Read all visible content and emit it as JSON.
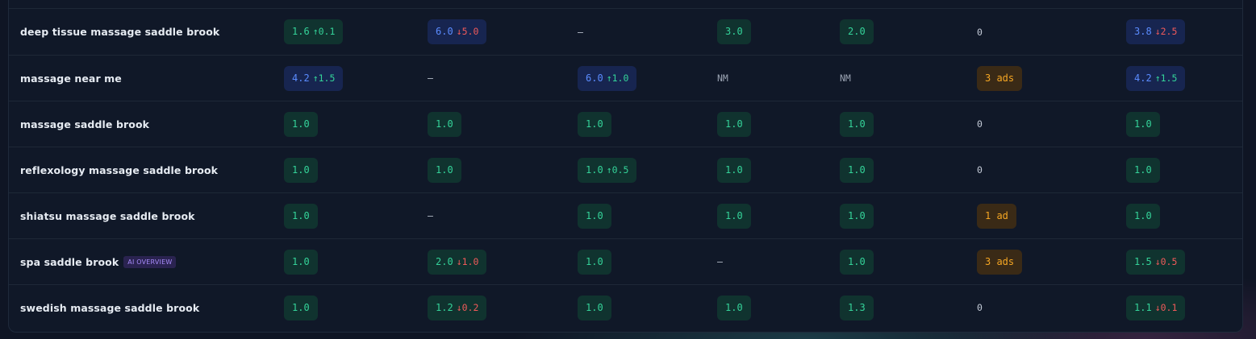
{
  "rows": [
    {
      "keyword": "deep tissue massage saddle brook",
      "cells": [
        {
          "kind": "badge",
          "tone": "green",
          "value": "1.6",
          "delta": "↑0.1",
          "dir": "up"
        },
        {
          "kind": "badge",
          "tone": "blue",
          "value": "6.0",
          "delta": "↓5.0",
          "dir": "down"
        },
        {
          "kind": "plain",
          "value": "–"
        },
        {
          "kind": "badge",
          "tone": "green",
          "value": "3.0"
        },
        {
          "kind": "badge",
          "tone": "green",
          "value": "2.0"
        },
        {
          "kind": "plain",
          "value": "0"
        },
        {
          "kind": "badge",
          "tone": "blue",
          "value": "3.8",
          "delta": "↓2.5",
          "dir": "down"
        }
      ]
    },
    {
      "keyword": "massage near me",
      "cells": [
        {
          "kind": "badge",
          "tone": "blue",
          "value": "4.2",
          "delta": "↑1.5",
          "dir": "up"
        },
        {
          "kind": "plain",
          "value": "–"
        },
        {
          "kind": "badge",
          "tone": "blue",
          "value": "6.0",
          "delta": "↑1.0",
          "dir": "up"
        },
        {
          "kind": "plain",
          "value": "NM",
          "dim": true
        },
        {
          "kind": "plain",
          "value": "NM",
          "dim": true
        },
        {
          "kind": "badge",
          "tone": "amber",
          "value": "3 ads"
        },
        {
          "kind": "badge",
          "tone": "blue",
          "value": "4.2",
          "delta": "↑1.5",
          "dir": "up"
        }
      ]
    },
    {
      "keyword": "massage saddle brook",
      "cells": [
        {
          "kind": "badge",
          "tone": "green",
          "value": "1.0"
        },
        {
          "kind": "badge",
          "tone": "green",
          "value": "1.0"
        },
        {
          "kind": "badge",
          "tone": "green",
          "value": "1.0"
        },
        {
          "kind": "badge",
          "tone": "green",
          "value": "1.0"
        },
        {
          "kind": "badge",
          "tone": "green",
          "value": "1.0"
        },
        {
          "kind": "plain",
          "value": "0"
        },
        {
          "kind": "badge",
          "tone": "green",
          "value": "1.0"
        }
      ]
    },
    {
      "keyword": "reflexology massage saddle brook",
      "cells": [
        {
          "kind": "badge",
          "tone": "green",
          "value": "1.0"
        },
        {
          "kind": "badge",
          "tone": "green",
          "value": "1.0"
        },
        {
          "kind": "badge",
          "tone": "green",
          "value": "1.0",
          "delta": "↑0.5",
          "dir": "up"
        },
        {
          "kind": "badge",
          "tone": "green",
          "value": "1.0"
        },
        {
          "kind": "badge",
          "tone": "green",
          "value": "1.0"
        },
        {
          "kind": "plain",
          "value": "0"
        },
        {
          "kind": "badge",
          "tone": "green",
          "value": "1.0"
        }
      ]
    },
    {
      "keyword": "shiatsu massage saddle brook",
      "cells": [
        {
          "kind": "badge",
          "tone": "green",
          "value": "1.0"
        },
        {
          "kind": "plain",
          "value": "–"
        },
        {
          "kind": "badge",
          "tone": "green",
          "value": "1.0"
        },
        {
          "kind": "badge",
          "tone": "green",
          "value": "1.0"
        },
        {
          "kind": "badge",
          "tone": "green",
          "value": "1.0"
        },
        {
          "kind": "badge",
          "tone": "amber",
          "value": "1 ad"
        },
        {
          "kind": "badge",
          "tone": "green",
          "value": "1.0"
        }
      ]
    },
    {
      "keyword": "spa saddle brook",
      "tag": "AI OVERVIEW",
      "cells": [
        {
          "kind": "badge",
          "tone": "green",
          "value": "1.0"
        },
        {
          "kind": "badge",
          "tone": "green",
          "value": "2.0",
          "delta": "↓1.0",
          "dir": "down"
        },
        {
          "kind": "badge",
          "tone": "green",
          "value": "1.0"
        },
        {
          "kind": "plain",
          "value": "–"
        },
        {
          "kind": "badge",
          "tone": "green",
          "value": "1.0"
        },
        {
          "kind": "badge",
          "tone": "amber",
          "value": "3 ads"
        },
        {
          "kind": "badge",
          "tone": "green",
          "value": "1.5",
          "delta": "↓0.5",
          "dir": "down"
        }
      ]
    },
    {
      "keyword": "swedish massage saddle brook",
      "cells": [
        {
          "kind": "badge",
          "tone": "green",
          "value": "1.0"
        },
        {
          "kind": "badge",
          "tone": "green",
          "value": "1.2",
          "delta": "↓0.2",
          "dir": "down"
        },
        {
          "kind": "badge",
          "tone": "green",
          "value": "1.0"
        },
        {
          "kind": "badge",
          "tone": "green",
          "value": "1.0"
        },
        {
          "kind": "badge",
          "tone": "green",
          "value": "1.3"
        },
        {
          "kind": "plain",
          "value": "0"
        },
        {
          "kind": "badge",
          "tone": "green",
          "value": "1.1",
          "delta": "↓0.1",
          "dir": "down"
        }
      ]
    }
  ],
  "colors": {
    "panel_bg": "#101828",
    "green_badge_bg": "#10332f",
    "green_text": "#34d399",
    "blue_badge_bg": "#172550",
    "blue_text": "#5b8cff",
    "amber_badge_bg": "#3a2a16",
    "amber_text": "#f5a623",
    "down_text": "#f05a5a"
  }
}
